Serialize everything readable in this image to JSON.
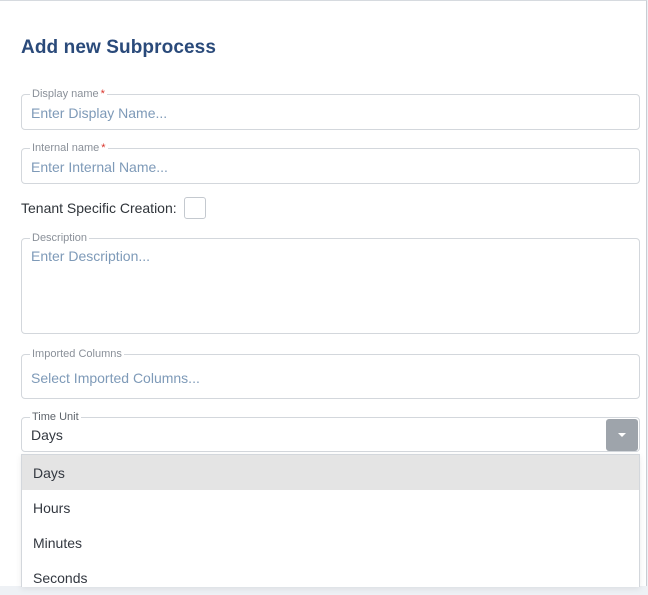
{
  "dialog": {
    "title": "Add new Subprocess"
  },
  "fields": {
    "display_name": {
      "label": "Display name",
      "required_mark": "*",
      "placeholder": "Enter Display Name..."
    },
    "internal_name": {
      "label": "Internal name",
      "required_mark": "*",
      "placeholder": "Enter Internal Name..."
    },
    "tenant_specific": {
      "label": "Tenant Specific Creation:",
      "checked": false
    },
    "description": {
      "label": "Description",
      "placeholder": "Enter Description..."
    },
    "imported_columns": {
      "label": "Imported Columns",
      "placeholder": "Select Imported Columns..."
    },
    "time_unit": {
      "label": "Time Unit",
      "value": "Days",
      "options": [
        "Days",
        "Hours",
        "Minutes",
        "Seconds"
      ],
      "selected_index": 0
    }
  },
  "icons": {
    "dropdown": "caret-down-icon"
  },
  "colors": {
    "title": "#2a4a7a",
    "placeholder": "#7e9ab8",
    "required": "#d9342b",
    "dropdown_button": "#9ea4ab",
    "selected_option": "#e4e4e4"
  }
}
